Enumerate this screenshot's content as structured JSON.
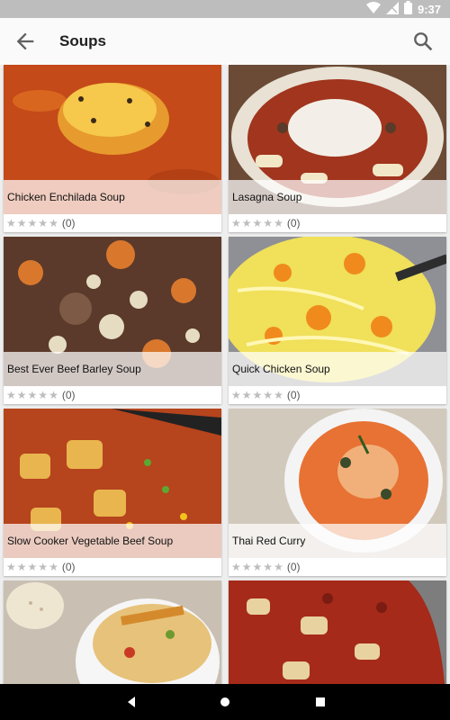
{
  "status_bar": {
    "time": "9:37"
  },
  "app_bar": {
    "title": "Soups",
    "back_icon": "arrow-back-icon",
    "search_icon": "search-icon"
  },
  "colors": {
    "app_bar": "#fafafa",
    "status_bar": "#bdbdbd",
    "background": "#eeeeee",
    "nav_bar": "#000000"
  },
  "recipes": [
    {
      "name": "Chicken Enchilada Soup",
      "rating": 0,
      "reviews": "(0)"
    },
    {
      "name": "Lasagna Soup",
      "rating": 0,
      "reviews": "(0)"
    },
    {
      "name": "Best Ever Beef Barley Soup",
      "rating": 0,
      "reviews": "(0)"
    },
    {
      "name": "Quick Chicken Soup",
      "rating": 0,
      "reviews": "(0)"
    },
    {
      "name": "Slow Cooker Vegetable Beef Soup",
      "rating": 0,
      "reviews": "(0)"
    },
    {
      "name": "Thai Red Curry",
      "rating": 0,
      "reviews": "(0)"
    },
    {
      "name": "",
      "rating": 0,
      "reviews": ""
    },
    {
      "name": "",
      "rating": 0,
      "reviews": ""
    }
  ],
  "nav_bar": {
    "icons": [
      "back-triangle-icon",
      "home-circle-icon",
      "recents-square-icon"
    ]
  }
}
